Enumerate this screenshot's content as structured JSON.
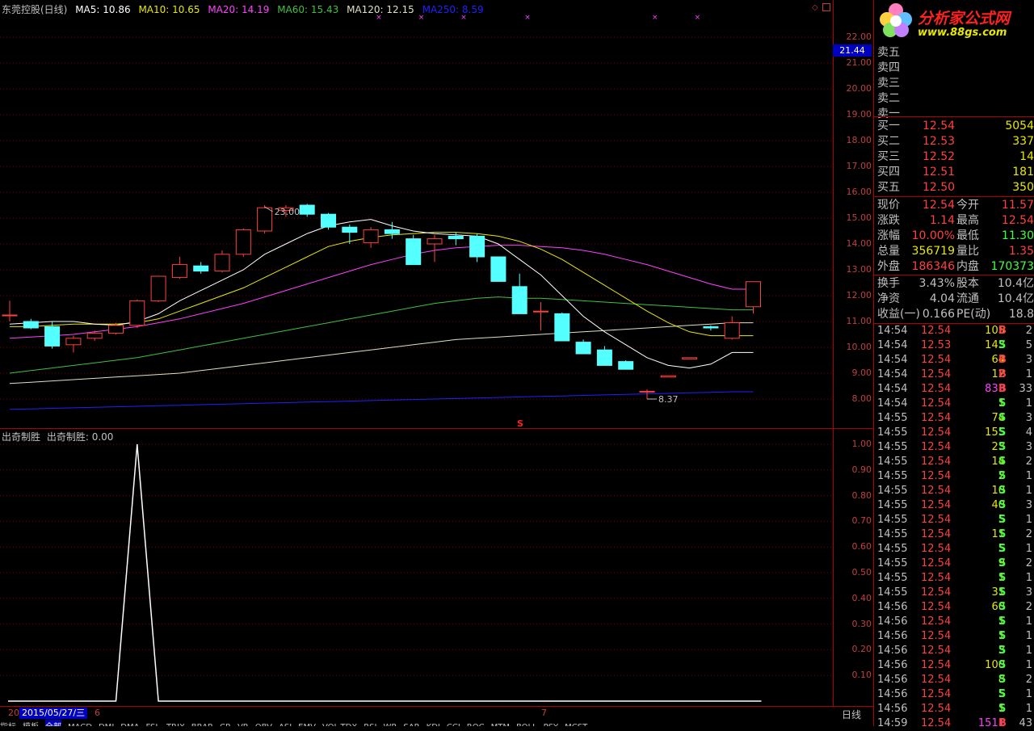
{
  "header": {
    "stock_name": "东莞控股(日线)",
    "ma5": "MA5: 10.86",
    "ma10": "MA10: 10.65",
    "ma20": "MA20: 14.19",
    "ma60": "MA60: 15.43",
    "ma120": "MA120: 12.15",
    "ma250": "MA250: 8.59"
  },
  "colors": {
    "up": "#ff4040",
    "down": "#54ffff",
    "ma5": "#ffffff",
    "ma10": "#e8e800",
    "ma20": "#ff40ff",
    "ma60": "#40c040",
    "ma120": "#e0e0c0",
    "ma250": "#2020ff",
    "grid": "#800000"
  },
  "price_axis": {
    "ticks": [
      "22.00",
      "21.00",
      "20.00",
      "19.00",
      "18.00",
      "17.00",
      "16.00",
      "15.00",
      "14.00",
      "13.00",
      "12.00",
      "11.00",
      "10.00",
      "9.00",
      "8.00"
    ],
    "cursor_value": "21.44"
  },
  "indicator": {
    "title": "出奇制胜",
    "value_label": "出奇制胜: 0.00",
    "ticks": [
      "1.00",
      "0.90",
      "0.80",
      "0.70",
      "0.60",
      "0.50",
      "0.40",
      "0.30",
      "0.20",
      "0.10"
    ]
  },
  "annotations": {
    "high_label": "23.00",
    "low_label": "8.37",
    "s_marker": "S"
  },
  "bottom": {
    "date_prefix": "20",
    "date": "2015/05/27/三",
    "month_6": "6",
    "month_7": "7",
    "period": "日线",
    "tabs": [
      "指标",
      "模板",
      "全部",
      "MACD",
      "DMI",
      "DMA",
      "FSL",
      "TRIX",
      "BRAR",
      "CR",
      "VR",
      "OBV",
      "ASI",
      "EMV",
      "VOL-TDX",
      "RSI",
      "WR",
      "SAR",
      "KDJ",
      "CCI",
      "ROC",
      "MTM",
      "BOLL",
      "PSY",
      "MCST"
    ]
  },
  "logo": {
    "name": "分析家公式网",
    "url": "www.88gs.com"
  },
  "order_book": {
    "sell": [
      {
        "label": "卖五",
        "price": "",
        "vol": ""
      },
      {
        "label": "卖四",
        "price": "",
        "vol": ""
      },
      {
        "label": "卖三",
        "price": "",
        "vol": ""
      },
      {
        "label": "卖二",
        "price": "",
        "vol": ""
      },
      {
        "label": "卖一",
        "price": "",
        "vol": ""
      }
    ],
    "buy": [
      {
        "label": "买一",
        "price": "12.54",
        "vol": "5054"
      },
      {
        "label": "买二",
        "price": "12.53",
        "vol": "337"
      },
      {
        "label": "买三",
        "price": "12.52",
        "vol": "14"
      },
      {
        "label": "买四",
        "price": "12.51",
        "vol": "181"
      },
      {
        "label": "买五",
        "price": "12.50",
        "vol": "350"
      }
    ]
  },
  "quote": [
    {
      "l1": "现价",
      "v1": "12.54",
      "c1": "#ff4040",
      "l2": "今开",
      "v2": "11.57",
      "c2": "#ff4040"
    },
    {
      "l1": "涨跌",
      "v1": "1.14",
      "c1": "#ff4040",
      "l2": "最高",
      "v2": "12.54",
      "c2": "#ff4040"
    },
    {
      "l1": "涨幅",
      "v1": "10.00%",
      "c1": "#ff4040",
      "l2": "最低",
      "v2": "11.30",
      "c2": "#40ff40"
    },
    {
      "l1": "总量",
      "v1": "356719",
      "c1": "#e8e800",
      "l2": "量比",
      "v2": "1.35",
      "c2": "#ff4040"
    },
    {
      "l1": "外盘",
      "v1": "186346",
      "c1": "#ff4040",
      "l2": "内盘",
      "v2": "170373",
      "c2": "#40ff40"
    }
  ],
  "fundamentals": [
    {
      "l1": "换手",
      "v1": "3.43%",
      "l2": "股本",
      "v2": "10.4亿"
    },
    {
      "l1": "净资",
      "v1": "4.04",
      "l2": "流通",
      "v2": "10.4亿"
    },
    {
      "l1": "收益(一)",
      "v1": "0.166",
      "l2": "PE(动)",
      "v2": "18.8"
    }
  ],
  "ticks": [
    {
      "t": "14:54",
      "p": "12.54",
      "v": "105",
      "bs": "B",
      "n": "2"
    },
    {
      "t": "14:54",
      "p": "12.53",
      "v": "143",
      "bs": "S",
      "n": "5"
    },
    {
      "t": "14:54",
      "p": "12.54",
      "v": "64",
      "bs": "B",
      "n": "3"
    },
    {
      "t": "14:54",
      "p": "12.54",
      "v": "12",
      "bs": "B",
      "n": "1"
    },
    {
      "t": "14:54",
      "p": "12.54",
      "v": "833",
      "bs": "B",
      "n": "33"
    },
    {
      "t": "14:54",
      "p": "12.54",
      "v": "1",
      "bs": "S",
      "n": "1"
    },
    {
      "t": "14:55",
      "p": "12.54",
      "v": "74",
      "bs": "S",
      "n": "3"
    },
    {
      "t": "14:55",
      "p": "12.54",
      "v": "155",
      "bs": "S",
      "n": "4"
    },
    {
      "t": "14:55",
      "p": "12.54",
      "v": "23",
      "bs": "S",
      "n": "3"
    },
    {
      "t": "14:55",
      "p": "12.54",
      "v": "14",
      "bs": "S",
      "n": "2"
    },
    {
      "t": "14:55",
      "p": "12.54",
      "v": "2",
      "bs": "S",
      "n": "1"
    },
    {
      "t": "14:55",
      "p": "12.54",
      "v": "10",
      "bs": "S",
      "n": "1"
    },
    {
      "t": "14:55",
      "p": "12.54",
      "v": "40",
      "bs": "S",
      "n": "3"
    },
    {
      "t": "14:55",
      "p": "12.54",
      "v": "5",
      "bs": "S",
      "n": "1"
    },
    {
      "t": "14:55",
      "p": "12.54",
      "v": "11",
      "bs": "S",
      "n": "2"
    },
    {
      "t": "14:55",
      "p": "12.54",
      "v": "5",
      "bs": "S",
      "n": "1"
    },
    {
      "t": "14:55",
      "p": "12.54",
      "v": "9",
      "bs": "S",
      "n": "2"
    },
    {
      "t": "14:55",
      "p": "12.54",
      "v": "1",
      "bs": "S",
      "n": "1"
    },
    {
      "t": "14:55",
      "p": "12.54",
      "v": "31",
      "bs": "S",
      "n": "3"
    },
    {
      "t": "14:56",
      "p": "12.54",
      "v": "60",
      "bs": "S",
      "n": "2"
    },
    {
      "t": "14:56",
      "p": "12.54",
      "v": "1",
      "bs": "S",
      "n": "1"
    },
    {
      "t": "14:56",
      "p": "12.54",
      "v": "1",
      "bs": "S",
      "n": "1"
    },
    {
      "t": "14:56",
      "p": "12.54",
      "v": "3",
      "bs": "S",
      "n": "1"
    },
    {
      "t": "14:56",
      "p": "12.54",
      "v": "100",
      "bs": "S",
      "n": "1"
    },
    {
      "t": "14:56",
      "p": "12.54",
      "v": "8",
      "bs": "S",
      "n": "2"
    },
    {
      "t": "14:56",
      "p": "12.54",
      "v": "5",
      "bs": "S",
      "n": "1"
    },
    {
      "t": "14:56",
      "p": "12.54",
      "v": "1",
      "bs": "S",
      "n": "1"
    },
    {
      "t": "14:59",
      "p": "12.54",
      "v": "1511",
      "bs": "B",
      "n": "43"
    }
  ],
  "chart_data": [
    {
      "type": "candlestick",
      "title": "东莞控股(日线)",
      "ylim": [
        7.5,
        22.5
      ],
      "candles": [
        {
          "o": 11.25,
          "h": 11.8,
          "l": 11.0,
          "c": 11.25
        },
        {
          "o": 11.0,
          "h": 11.1,
          "l": 10.7,
          "c": 10.75
        },
        {
          "o": 10.8,
          "h": 11.0,
          "l": 9.95,
          "c": 10.05
        },
        {
          "o": 10.1,
          "h": 10.45,
          "l": 9.8,
          "c": 10.35
        },
        {
          "o": 10.35,
          "h": 10.65,
          "l": 10.25,
          "c": 10.55
        },
        {
          "o": 10.55,
          "h": 10.95,
          "l": 10.5,
          "c": 10.85
        },
        {
          "o": 10.85,
          "h": 11.85,
          "l": 10.75,
          "c": 11.8
        },
        {
          "o": 11.8,
          "h": 12.5,
          "l": 11.75,
          "c": 12.75
        },
        {
          "o": 12.7,
          "h": 13.5,
          "l": 12.65,
          "c": 13.2
        },
        {
          "o": 13.15,
          "h": 13.3,
          "l": 12.85,
          "c": 12.95
        },
        {
          "o": 12.95,
          "h": 13.75,
          "l": 12.9,
          "c": 13.6
        },
        {
          "o": 13.6,
          "h": 14.6,
          "l": 13.5,
          "c": 14.55
        },
        {
          "o": 14.5,
          "h": 15.5,
          "l": 14.4,
          "c": 15.4
        },
        {
          "o": 15.3,
          "h": 15.5,
          "l": 15.05,
          "c": 15.4
        },
        {
          "o": 15.5,
          "h": 15.55,
          "l": 15.05,
          "c": 15.15
        },
        {
          "o": 15.15,
          "h": 15.2,
          "l": 14.55,
          "c": 14.65
        },
        {
          "o": 14.65,
          "h": 14.75,
          "l": 14.0,
          "c": 14.45
        },
        {
          "o": 14.05,
          "h": 14.65,
          "l": 13.85,
          "c": 14.55
        },
        {
          "o": 14.55,
          "h": 14.85,
          "l": 14.2,
          "c": 14.4
        },
        {
          "o": 14.2,
          "h": 14.35,
          "l": 13.2,
          "c": 13.2
        },
        {
          "o": 14.0,
          "h": 14.35,
          "l": 13.3,
          "c": 14.2
        },
        {
          "o": 14.3,
          "h": 14.45,
          "l": 13.95,
          "c": 14.2
        },
        {
          "o": 14.3,
          "h": 14.4,
          "l": 13.3,
          "c": 13.5
        },
        {
          "o": 13.5,
          "h": 13.5,
          "l": 12.55,
          "c": 12.55
        },
        {
          "o": 12.35,
          "h": 12.85,
          "l": 11.3,
          "c": 11.3
        },
        {
          "o": 11.4,
          "h": 11.75,
          "l": 10.65,
          "c": 11.4
        },
        {
          "o": 11.3,
          "h": 11.35,
          "l": 10.25,
          "c": 10.25
        },
        {
          "o": 10.2,
          "h": 10.3,
          "l": 9.75,
          "c": 9.75
        },
        {
          "o": 9.9,
          "h": 10.05,
          "l": 9.3,
          "c": 9.3
        },
        {
          "o": 9.45,
          "h": 9.5,
          "l": 9.15,
          "c": 9.15
        },
        {
          "o": 8.3,
          "h": 8.37,
          "l": 8.0,
          "c": 8.3
        },
        {
          "o": 8.85,
          "h": 8.9,
          "l": 8.85,
          "c": 8.9
        },
        {
          "o": 9.55,
          "h": 9.6,
          "l": 9.55,
          "c": 9.6
        },
        {
          "o": 10.8,
          "h": 10.85,
          "l": 10.65,
          "c": 10.75
        },
        {
          "o": 10.35,
          "h": 11.2,
          "l": 10.3,
          "c": 10.95
        },
        {
          "o": 11.57,
          "h": 12.54,
          "l": 11.3,
          "c": 12.54
        }
      ],
      "ma5": [
        10.9,
        10.95,
        11.0,
        11.0,
        10.9,
        10.85,
        11.0,
        11.3,
        11.8,
        12.2,
        12.6,
        13.0,
        13.6,
        14.0,
        14.4,
        14.7,
        14.85,
        14.95,
        14.7,
        14.5,
        14.4,
        14.35,
        14.3,
        14.0,
        13.4,
        12.8,
        12.0,
        11.2,
        10.6,
        10.1,
        9.6,
        9.3,
        9.2,
        9.35,
        9.8,
        10.86
      ],
      "ma10": [
        10.8,
        10.8,
        10.85,
        10.9,
        10.9,
        10.9,
        10.95,
        11.1,
        11.4,
        11.7,
        12.0,
        12.3,
        12.7,
        13.1,
        13.5,
        13.9,
        14.1,
        14.25,
        14.35,
        14.4,
        14.45,
        14.45,
        14.4,
        14.3,
        14.1,
        13.8,
        13.4,
        12.9,
        12.4,
        11.9,
        11.4,
        10.95,
        10.6,
        10.45,
        10.45,
        10.65
      ],
      "ma20": [
        10.35,
        10.4,
        10.45,
        10.5,
        10.6,
        10.7,
        10.8,
        10.95,
        11.1,
        11.3,
        11.5,
        11.7,
        11.95,
        12.2,
        12.45,
        12.7,
        12.95,
        13.2,
        13.4,
        13.6,
        13.75,
        13.85,
        13.9,
        13.95,
        13.95,
        13.9,
        13.85,
        13.75,
        13.6,
        13.4,
        13.2,
        12.95,
        12.7,
        12.45,
        12.25,
        14.19
      ],
      "ma60": [
        9.0,
        9.1,
        9.2,
        9.3,
        9.4,
        9.5,
        9.6,
        9.75,
        9.9,
        10.05,
        10.2,
        10.35,
        10.5,
        10.65,
        10.8,
        10.95,
        11.1,
        11.25,
        11.4,
        11.55,
        11.7,
        11.8,
        11.9,
        11.95,
        11.9,
        11.9,
        11.85,
        11.8,
        11.75,
        11.7,
        11.65,
        11.6,
        11.55,
        11.5,
        11.45,
        15.43
      ],
      "ma120": [
        8.6,
        8.65,
        8.7,
        8.75,
        8.8,
        8.85,
        8.9,
        8.95,
        9.0,
        9.1,
        9.2,
        9.3,
        9.4,
        9.5,
        9.6,
        9.7,
        9.8,
        9.9,
        10.0,
        10.1,
        10.2,
        10.3,
        10.35,
        10.4,
        10.45,
        10.5,
        10.55,
        10.6,
        10.65,
        10.7,
        10.75,
        10.8,
        10.85,
        10.9,
        10.95,
        12.15
      ],
      "ma250": [
        7.6,
        7.62,
        7.64,
        7.66,
        7.68,
        7.7,
        7.72,
        7.74,
        7.76,
        7.78,
        7.8,
        7.82,
        7.84,
        7.86,
        7.88,
        7.9,
        7.92,
        7.94,
        7.96,
        7.98,
        8.0,
        8.02,
        8.04,
        8.06,
        8.08,
        8.1,
        8.12,
        8.14,
        8.16,
        8.18,
        8.2,
        8.22,
        8.24,
        8.26,
        8.28,
        8.59
      ]
    },
    {
      "type": "line",
      "title": "出奇制胜",
      "ylim": [
        0,
        1.0
      ],
      "values": [
        0,
        0,
        0,
        0,
        0,
        0,
        1.0,
        0,
        0,
        0,
        0,
        0,
        0,
        0,
        0,
        0,
        0,
        0,
        0,
        0,
        0,
        0,
        0,
        0,
        0,
        0,
        0,
        0,
        0,
        0,
        0,
        0,
        0,
        0,
        0,
        0
      ]
    }
  ]
}
